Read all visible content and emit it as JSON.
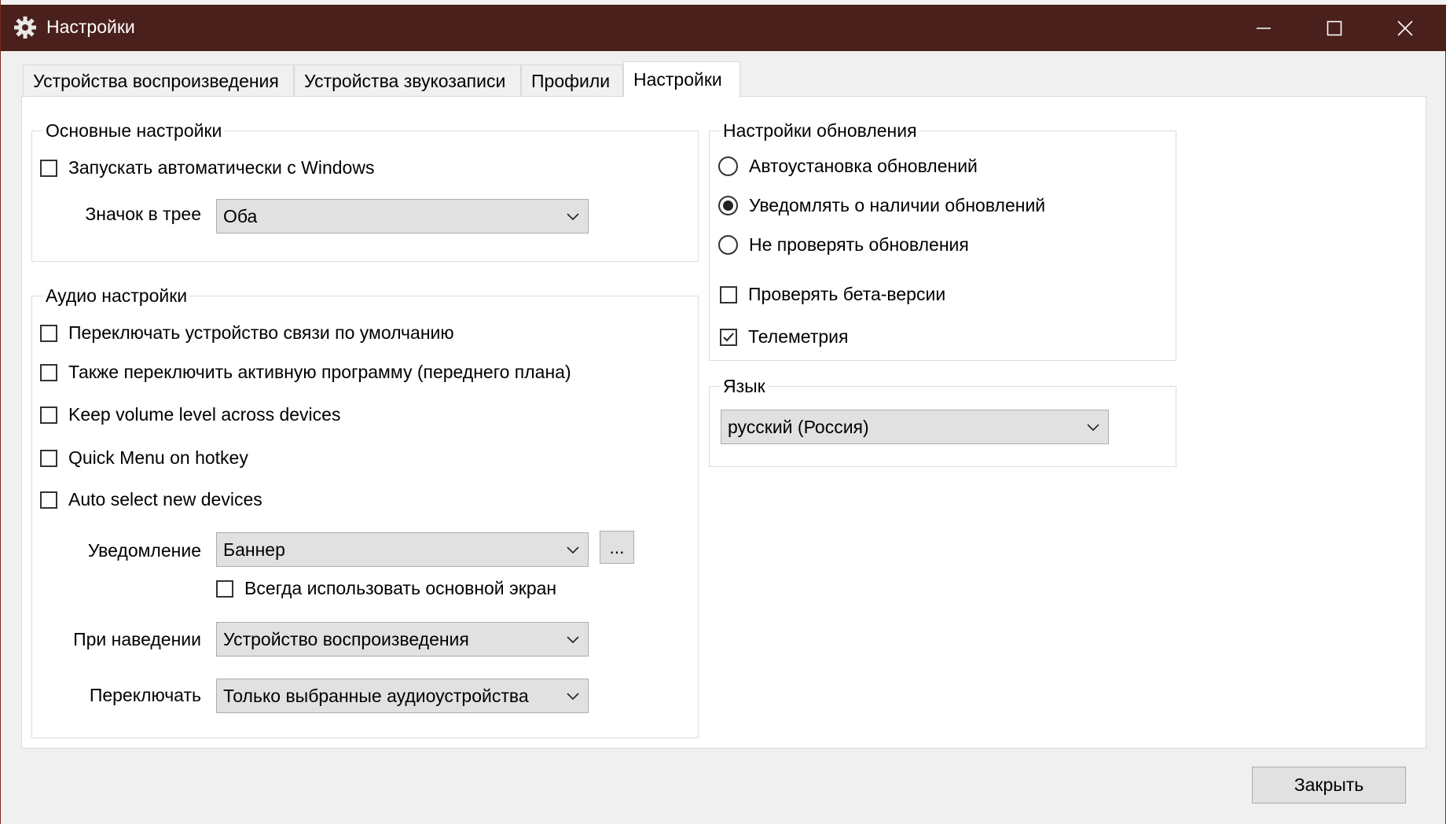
{
  "window": {
    "title": "Настройки"
  },
  "tabs": [
    {
      "label": "Устройства воспроизведения"
    },
    {
      "label": "Устройства звукозаписи"
    },
    {
      "label": "Профили"
    },
    {
      "label": "Настройки"
    }
  ],
  "basic": {
    "legend": "Основные настройки",
    "autostart": {
      "label": "Запускать автоматически с Windows",
      "checked": false
    },
    "tray_icon": {
      "label": "Значок в трее",
      "value": "Оба"
    }
  },
  "audio": {
    "legend": "Аудио настройки",
    "options": [
      {
        "label": "Переключать устройство связи по умолчанию",
        "checked": false
      },
      {
        "label": "Также переключить активную программу (переднего плана)",
        "checked": false
      },
      {
        "label": "Keep volume level across devices",
        "checked": false
      },
      {
        "label": "Quick Menu on hotkey",
        "checked": false
      },
      {
        "label": "Auto select new devices",
        "checked": false
      }
    ],
    "notification": {
      "label": "Уведомление",
      "value": "Баннер",
      "more_label": "..."
    },
    "primary_screen": {
      "label": "Всегда использовать основной экран",
      "checked": false
    },
    "on_hover": {
      "label": "При наведении",
      "value": "Устройство воспроизведения"
    },
    "switch": {
      "label": "Переключать",
      "value": "Только выбранные аудиоустройства"
    }
  },
  "update": {
    "legend": "Настройки обновления",
    "modes": [
      {
        "label": "Автоустановка обновлений",
        "selected": false
      },
      {
        "label": "Уведомлять о наличии обновлений",
        "selected": true
      },
      {
        "label": "Не проверять обновления",
        "selected": false
      }
    ],
    "beta": {
      "label": "Проверять бета-версии",
      "checked": false
    },
    "telemetry": {
      "label": "Телеметрия",
      "checked": true
    }
  },
  "language": {
    "legend": "Язык",
    "value": "русский (Россия)"
  },
  "footer": {
    "close_label": "Закрыть"
  },
  "colors": {
    "titlebar": "#4a201c",
    "accent_border": "#7a2a20"
  }
}
